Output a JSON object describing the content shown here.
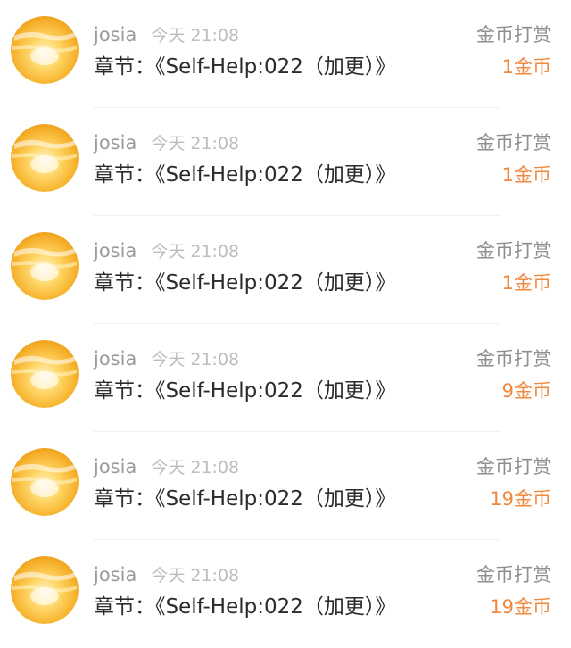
{
  "rewards": [
    {
      "user": "josia",
      "time": "今天 21:08",
      "chapter": "章节：《Self-Help:022（加更）》",
      "type_label": "金币打赏",
      "amount": "1金币",
      "avatar": "sunset-avatar-icon"
    },
    {
      "user": "josia",
      "time": "今天 21:08",
      "chapter": "章节：《Self-Help:022（加更）》",
      "type_label": "金币打赏",
      "amount": "1金币",
      "avatar": "sunset-avatar-icon"
    },
    {
      "user": "josia",
      "time": "今天 21:08",
      "chapter": "章节：《Self-Help:022（加更）》",
      "type_label": "金币打赏",
      "amount": "1金币",
      "avatar": "sunset-avatar-icon"
    },
    {
      "user": "josia",
      "time": "今天 21:08",
      "chapter": "章节：《Self-Help:022（加更）》",
      "type_label": "金币打赏",
      "amount": "9金币",
      "avatar": "sunset-avatar-icon"
    },
    {
      "user": "josia",
      "time": "今天 21:08",
      "chapter": "章节：《Self-Help:022（加更）》",
      "type_label": "金币打赏",
      "amount": "19金币",
      "avatar": "sunset-avatar-icon"
    },
    {
      "user": "josia",
      "time": "今天 21:08",
      "chapter": "章节：《Self-Help:022（加更）》",
      "type_label": "金币打赏",
      "amount": "19金币",
      "avatar": "sunset-avatar-icon"
    }
  ],
  "colors": {
    "amount": "#f0883e",
    "username": "#9b9b9b",
    "timestamp": "#bdbdbd",
    "chapter": "#2b2b2b",
    "type_label": "#8f8f8f"
  }
}
